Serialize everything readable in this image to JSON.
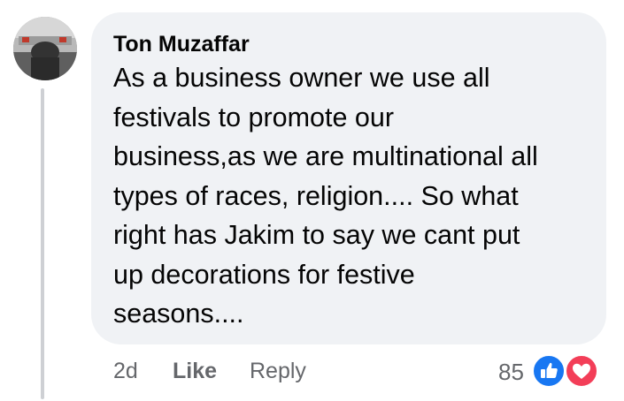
{
  "comment": {
    "author": "Ton Muzaffar",
    "lines": [
      "As a business owner we use all",
      "festivals to promote our",
      "business,as we are multinational all",
      "types of races, religion.... So what",
      "right has Jakim to say we cant put",
      "up decorations for festive",
      "seasons...."
    ],
    "time": "2d",
    "like_label": "Like",
    "reply_label": "Reply",
    "reaction_count": "85",
    "reactions": [
      "like-icon",
      "love-icon"
    ]
  },
  "colors": {
    "bubble": "#f0f2f5",
    "meta_text": "#65676b",
    "like_blue": "#1877f2",
    "love_red": "#f33e58"
  }
}
